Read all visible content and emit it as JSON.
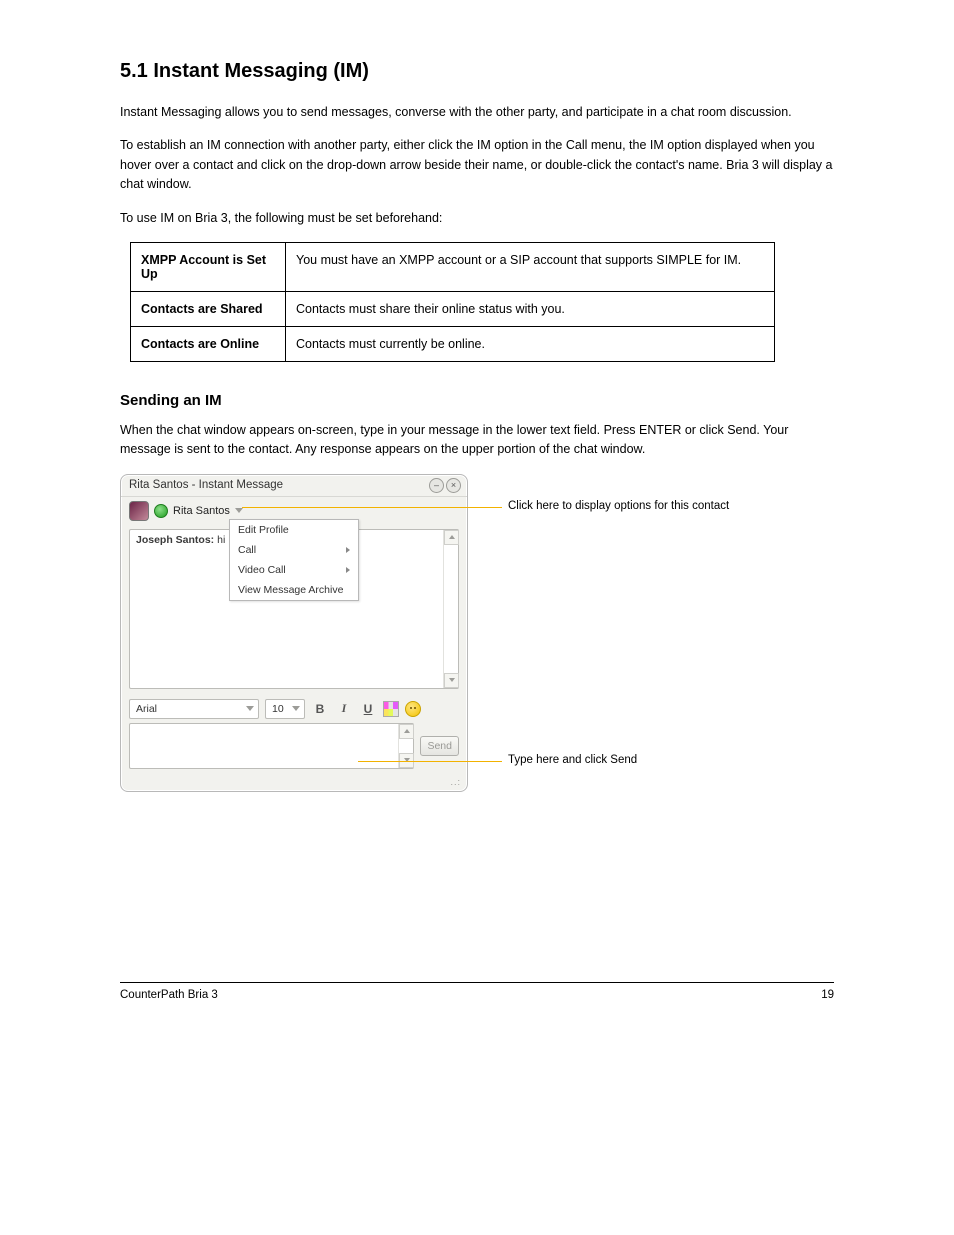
{
  "doc": {
    "section_title": "5.1 Instant Messaging (IM)",
    "intro_p1": "Instant Messaging allows you to send messages, converse with the other party, and participate in a chat room discussion.",
    "intro_p2": "To establish an IM connection with another party, either click the IM option in the Call menu, the IM option displayed when you hover over a contact and click on the drop-down arrow beside their name, or double-click the contact's name. Bria 3 will display a chat window.",
    "table_heading": "To use IM on Bria 3, the following must be set beforehand:",
    "table": [
      {
        "label": "XMPP Account is Set Up",
        "desc": "You must have an XMPP account or a SIP account that supports SIMPLE for IM."
      },
      {
        "label": "Contacts are Shared",
        "desc": "Contacts must share their online status with you."
      },
      {
        "label": "Contacts are Online",
        "desc": "Contacts must currently be online."
      }
    ],
    "subheading": "Sending an IM",
    "send_p": "When the chat window appears on-screen, type in your message in the lower text field. Press ENTER or click Send. Your message is sent to the contact. Any response appears on the upper portion of the chat window.",
    "callouts": {
      "a": "Click here to display options for this contact",
      "b": "Type here and click Send"
    }
  },
  "im": {
    "title": "Rita Santos - Instant Message",
    "contact": "Rita Santos",
    "msg_sender": "Joseph Santos:",
    "msg_text": "hi",
    "menu": {
      "edit_profile": "Edit Profile",
      "call": "Call",
      "video_call": "Video Call",
      "view_archive": "View Message Archive"
    },
    "font_name": "Arial",
    "font_size": "10",
    "bold": "B",
    "italic": "I",
    "underline": "U",
    "send": "Send"
  },
  "footer": {
    "left": "CounterPath Bria 3",
    "right": "19"
  }
}
